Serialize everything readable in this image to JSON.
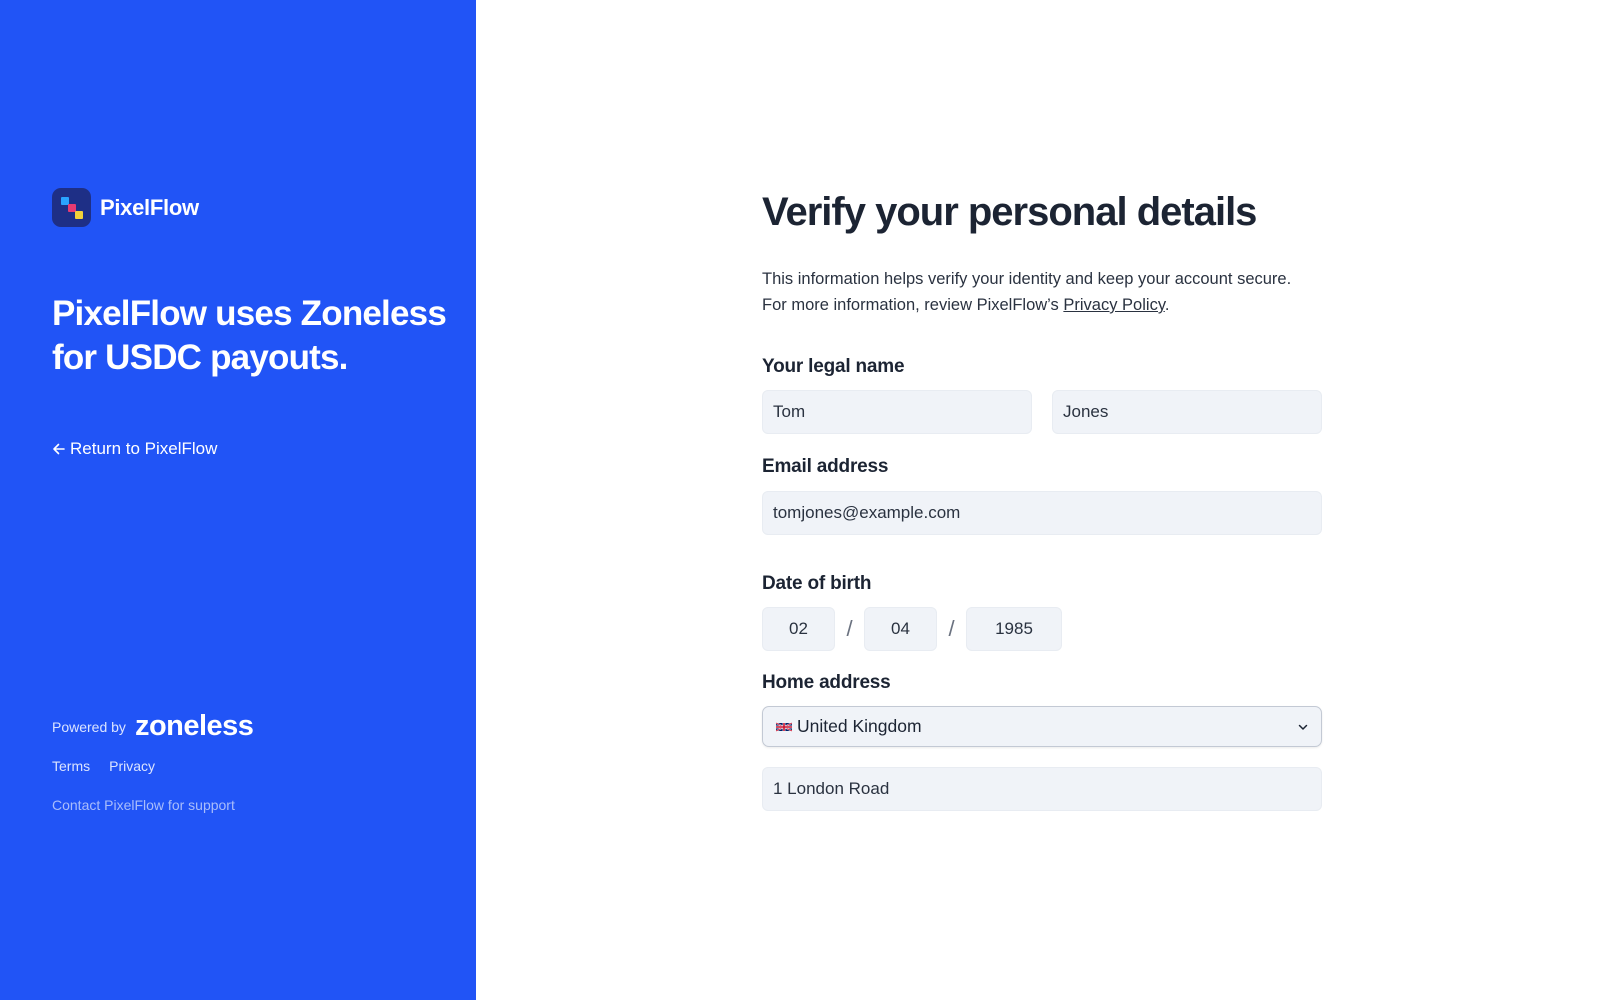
{
  "brand": {
    "name": "PixelFlow",
    "logo_colors": [
      "#2aa3ff",
      "#e83a72",
      "#f2d23a"
    ],
    "tagline": "PixelFlow uses Zoneless for USDC payouts.",
    "back_link": "Return to PixelFlow",
    "back_icon": "arrow-left-icon"
  },
  "footer": {
    "powered_label": "Powered by",
    "provider_logo": "zoneless",
    "links": [
      "Terms",
      "Privacy"
    ],
    "support": "Contact PixelFlow for support"
  },
  "form": {
    "title": "Verify your personal details",
    "desc_line1": "This information helps verify your identity and keep your account secure.",
    "desc_line2_prefix": "For more information, review PixelFlow’s ",
    "desc_link": "Privacy Policy",
    "desc_suffix": ".",
    "name_label": "Your legal name",
    "first_name": "Tom",
    "last_name": "Jones",
    "email_label": "Email address",
    "email": "tomjones@example.com",
    "dob_label": "Date of birth",
    "dob_day": "02",
    "dob_month": "04",
    "dob_year": "1985",
    "dob_sep": "/",
    "address_label": "Home address",
    "country": "United Kingdom",
    "country_flag": "gb-flag-icon",
    "street": "1 London Road"
  },
  "colors": {
    "side_bg": "#2154f6",
    "text_dark": "#1c2433",
    "field_bg": "#f0f3f8"
  }
}
